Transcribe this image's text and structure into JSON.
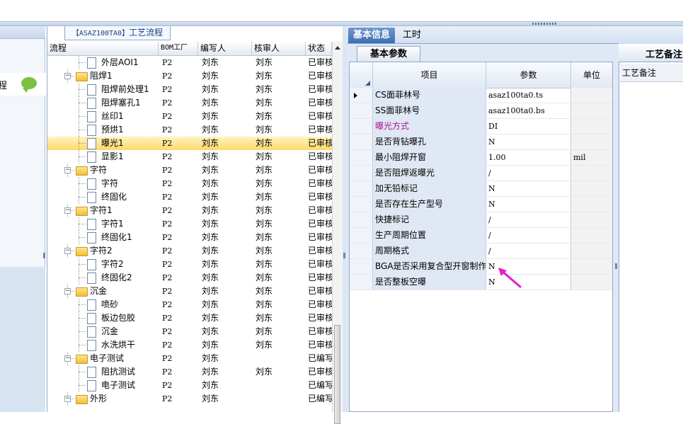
{
  "left_strip": {
    "item_label": "程"
  },
  "tree": {
    "tab_code": "【ASAZ100TA0】",
    "tab_label": "工艺流程",
    "headers": {
      "flow": "流程",
      "bom": "BOM工厂",
      "writer": "编写人",
      "reviewer": "核审人",
      "status": "状态"
    },
    "rows": [
      {
        "label": "外层AOI1",
        "type": "doc",
        "level": 2,
        "bom": "P2",
        "writer": "刘东",
        "reviewer": "刘东",
        "status": "已审核"
      },
      {
        "label": "阻焊1",
        "type": "folder",
        "level": 1,
        "bom": "P2",
        "writer": "刘东",
        "reviewer": "刘东",
        "status": "已审核"
      },
      {
        "label": "阻焊前处理1",
        "type": "doc",
        "level": 2,
        "bom": "P2",
        "writer": "刘东",
        "reviewer": "刘东",
        "status": "已审核"
      },
      {
        "label": "阻焊塞孔1",
        "type": "doc",
        "level": 2,
        "bom": "P2",
        "writer": "刘东",
        "reviewer": "刘东",
        "status": "已审核"
      },
      {
        "label": "丝印1",
        "type": "doc",
        "level": 2,
        "bom": "P2",
        "writer": "刘东",
        "reviewer": "刘东",
        "status": "已审核"
      },
      {
        "label": "预烘1",
        "type": "doc",
        "level": 2,
        "bom": "P2",
        "writer": "刘东",
        "reviewer": "刘东",
        "status": "已审核"
      },
      {
        "label": "曝光1",
        "type": "doc",
        "level": 2,
        "bom": "P2",
        "writer": "刘东",
        "reviewer": "刘东",
        "status": "已审核",
        "selected": true
      },
      {
        "label": "显影1",
        "type": "doc",
        "level": 2,
        "bom": "P2",
        "writer": "刘东",
        "reviewer": "刘东",
        "status": "已审核"
      },
      {
        "label": "字符",
        "type": "folder",
        "level": 1,
        "bom": "P2",
        "writer": "刘东",
        "reviewer": "刘东",
        "status": "已审核"
      },
      {
        "label": "字符",
        "type": "doc",
        "level": 2,
        "bom": "P2",
        "writer": "刘东",
        "reviewer": "刘东",
        "status": "已审核"
      },
      {
        "label": "终固化",
        "type": "doc",
        "level": 2,
        "bom": "P2",
        "writer": "刘东",
        "reviewer": "刘东",
        "status": "已审核"
      },
      {
        "label": "字符1",
        "type": "folder",
        "level": 1,
        "bom": "P2",
        "writer": "刘东",
        "reviewer": "刘东",
        "status": "已审核"
      },
      {
        "label": "字符1",
        "type": "doc",
        "level": 2,
        "bom": "P2",
        "writer": "刘东",
        "reviewer": "刘东",
        "status": "已审核"
      },
      {
        "label": "终固化1",
        "type": "doc",
        "level": 2,
        "bom": "P2",
        "writer": "刘东",
        "reviewer": "刘东",
        "status": "已审核"
      },
      {
        "label": "字符2",
        "type": "folder",
        "level": 1,
        "bom": "P2",
        "writer": "刘东",
        "reviewer": "刘东",
        "status": "已审核"
      },
      {
        "label": "字符2",
        "type": "doc",
        "level": 2,
        "bom": "P2",
        "writer": "刘东",
        "reviewer": "刘东",
        "status": "已审核"
      },
      {
        "label": "终固化2",
        "type": "doc",
        "level": 2,
        "bom": "P2",
        "writer": "刘东",
        "reviewer": "刘东",
        "status": "已审核"
      },
      {
        "label": "沉金",
        "type": "folder",
        "level": 1,
        "bom": "P2",
        "writer": "刘东",
        "reviewer": "刘东",
        "status": "已审核"
      },
      {
        "label": "喷砂",
        "type": "doc",
        "level": 2,
        "bom": "P2",
        "writer": "刘东",
        "reviewer": "刘东",
        "status": "已审核"
      },
      {
        "label": "板边包胶",
        "type": "doc",
        "level": 2,
        "bom": "P2",
        "writer": "刘东",
        "reviewer": "刘东",
        "status": "已审核"
      },
      {
        "label": "沉金",
        "type": "doc",
        "level": 2,
        "bom": "P2",
        "writer": "刘东",
        "reviewer": "刘东",
        "status": "已审核"
      },
      {
        "label": "水洗烘干",
        "type": "doc",
        "level": 2,
        "bom": "P2",
        "writer": "刘东",
        "reviewer": "刘东",
        "status": "已审核"
      },
      {
        "label": "电子测试",
        "type": "folder",
        "level": 1,
        "bom": "P2",
        "writer": "刘东",
        "reviewer": "",
        "status": "已编写"
      },
      {
        "label": "阻抗测试",
        "type": "doc",
        "level": 2,
        "bom": "P2",
        "writer": "刘东",
        "reviewer": "刘东",
        "status": "已审核"
      },
      {
        "label": "电子测试",
        "type": "doc",
        "level": 2,
        "bom": "P2",
        "writer": "刘东",
        "reviewer": "",
        "status": "已编写"
      },
      {
        "label": "外形",
        "type": "folder",
        "level": 1,
        "bom": "P2",
        "writer": "刘东",
        "reviewer": "",
        "status": "已编写"
      }
    ]
  },
  "tabs": {
    "basic_info": "基本信息",
    "work_hours": "工时"
  },
  "basic_params": {
    "tab_label": "基本参数",
    "headers": {
      "item": "项目",
      "param": "参数",
      "unit": "单位"
    },
    "highlight_color": "#b0148c",
    "rows": [
      {
        "item": "CS面菲林号",
        "param": "asaz100ta0.ts",
        "unit": "",
        "current": true
      },
      {
        "item": "SS面菲林号",
        "param": "asaz100ta0.bs",
        "unit": ""
      },
      {
        "item": "曝光方式",
        "param": "DI",
        "unit": "",
        "highlight": true
      },
      {
        "item": "是否背钻曝孔",
        "param": "N",
        "unit": ""
      },
      {
        "item": "最小阻焊开窗",
        "param": "1.00",
        "unit": "mil"
      },
      {
        "item": "是否阻焊返曝光",
        "param": "/",
        "unit": ""
      },
      {
        "item": "加无铅标记",
        "param": "N",
        "unit": ""
      },
      {
        "item": "是否存在生产型号",
        "param": "N",
        "unit": ""
      },
      {
        "item": "快捷标记",
        "param": "/",
        "unit": ""
      },
      {
        "item": "生产周期位置",
        "param": "/",
        "unit": ""
      },
      {
        "item": "周期格式",
        "param": "/",
        "unit": ""
      },
      {
        "item": "BGA是否采用复合型开窗制作",
        "param": "N",
        "unit": ""
      },
      {
        "item": "是否整板空曝",
        "param": "N",
        "unit": ""
      }
    ]
  },
  "process_notes": {
    "tab_label": "工艺备注",
    "header": "工艺备注"
  }
}
